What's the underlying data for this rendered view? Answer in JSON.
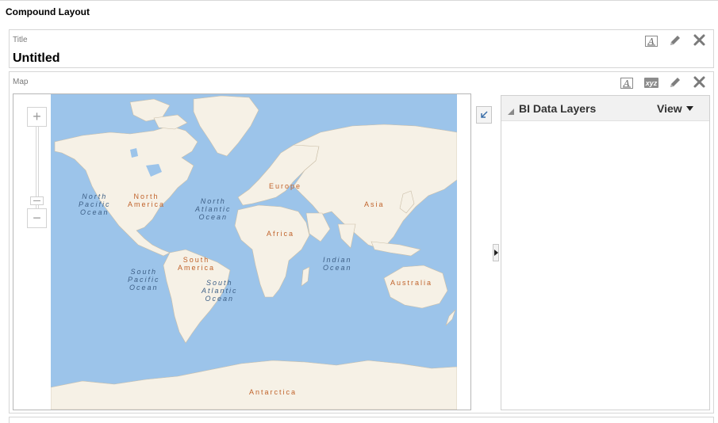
{
  "page": {
    "title": "Compound Layout"
  },
  "title_view": {
    "label": "Title",
    "value": "Untitled",
    "tools": [
      {
        "name": "format-text-icon"
      },
      {
        "name": "edit-pencil-icon"
      },
      {
        "name": "remove-x-icon"
      }
    ]
  },
  "map_view": {
    "label": "Map",
    "tools": [
      {
        "name": "format-text-icon"
      },
      {
        "name": "rename-xyz-icon",
        "text": "xyz"
      },
      {
        "name": "edit-pencil-icon"
      },
      {
        "name": "remove-x-icon"
      }
    ],
    "zoom": {
      "in": "+",
      "out": "−"
    },
    "labels": {
      "north_america": "North\nAmerica",
      "south_america": "South\nAmerica",
      "europe": "Europe",
      "africa": "Africa",
      "asia": "Asia",
      "australia": "Australia",
      "antarctica": "Antarctica",
      "north_pacific": "North\nPacific\nOcean",
      "south_pacific": "South\nPacific\nOcean",
      "north_atlantic": "North\nAtlantic\nOcean",
      "south_atlantic": "South\nAtlantic\nOcean",
      "indian": "Indian\nOcean"
    }
  },
  "layers_panel": {
    "title": "BI Data Layers",
    "view_menu": "View"
  },
  "colors": {
    "ocean": "#9cc4ea",
    "land": "#f6f1e6",
    "continent_label": "#c0622a",
    "ocean_label": "#3d5f86"
  }
}
